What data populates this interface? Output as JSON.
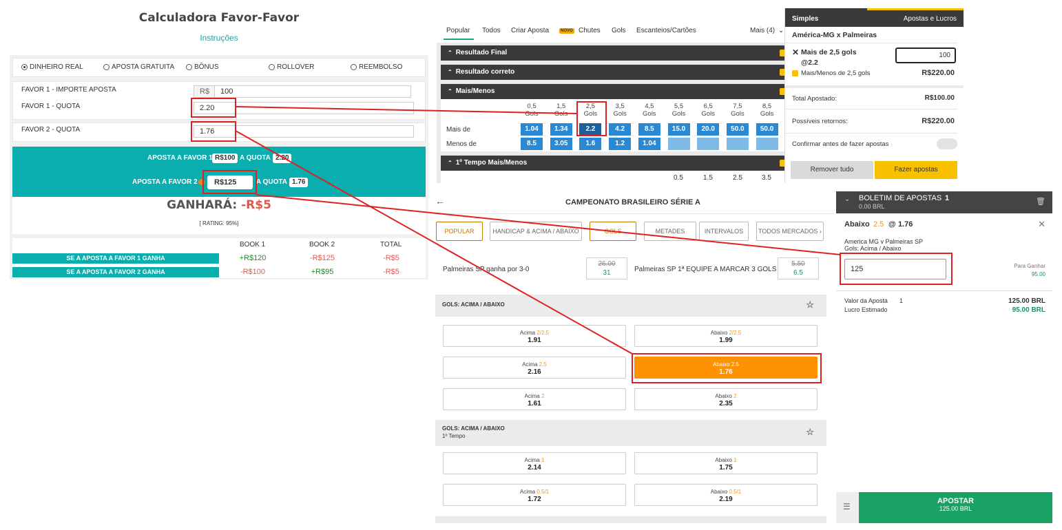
{
  "calc": {
    "title": "Calculadora Favor-Favor",
    "instructions": "Instruções",
    "radios": [
      "DINHEIRO REAL",
      "APOSTA GRATUITA",
      "BÔNUS",
      "ROLLOVER",
      "REEMBOLSO"
    ],
    "fav1_stake_label": "FAVOR 1 - IMPORTE APOSTA",
    "currency": "R$",
    "fav1_stake_value": "100",
    "fav1_odd_label": "FAVOR 1 - QUOTA",
    "fav1_odd_value": "2.20",
    "fav2_odd_label": "FAVOR 2 - QUOTA",
    "fav2_odd_value": "1.76",
    "bet1_label": "APOSTA A FAVOR 1",
    "bet1_amount": "R$100",
    "bet1_quota_label": "A QUOTA",
    "bet1_quota": "2.20",
    "bet2_label": "APOSTA A FAVOR 2",
    "bet2_amount": "R$125",
    "bet2_quota_label": "A QUOTA",
    "bet2_quota": "1.76",
    "win_label": "GANHARÁ:",
    "win_value": "-R$5",
    "rating": "[ RATING: 95%]",
    "table_headers": [
      "BOOK 1",
      "BOOK 2",
      "TOTAL"
    ],
    "rows": [
      {
        "label": "SE A APOSTA A FAVOR 1 GANHA",
        "book1": "+R$120",
        "book2": "-R$125",
        "total": "-R$5"
      },
      {
        "label": "SE A APOSTA A FAVOR 2 GANHA",
        "book1": "-R$100",
        "book2": "+R$95",
        "total": "-R$5"
      }
    ]
  },
  "b365": {
    "tabs": [
      "Popular",
      "Todos",
      "Criar Aposta",
      "Chutes",
      "Gols",
      "Escanteios/Cartões"
    ],
    "novo": "NOVO",
    "more": "Mais (4)",
    "sections": [
      "Resultado Final",
      "Resultado correto",
      "Mais/Menos",
      "1º Tempo Mais/Menos"
    ],
    "goal_word": "Gols",
    "goals": [
      "0,5",
      "1,5",
      "2,5",
      "3,5",
      "4,5",
      "5,5",
      "6,5",
      "7,5",
      "8,5"
    ],
    "over_label": "Mais de",
    "under_label": "Menos de",
    "over_odds": [
      "1.04",
      "1.34",
      "2.2",
      "4.2",
      "8.5",
      "15.0",
      "20.0",
      "50.0",
      "50.0"
    ],
    "under_odds": [
      "8.5",
      "3.05",
      "1.6",
      "1.2",
      "1.04",
      "",
      "",
      "",
      ""
    ],
    "half_goals": [
      "0.5",
      "1.5",
      "2.5",
      "3.5"
    ],
    "slip": {
      "simples": "Simples",
      "apostas_lucros": "Apostas e Lucros",
      "match": "América-MG x Palmeiras",
      "selection": "Mais de 2,5 gols",
      "odd": "@2.2",
      "stake": "100",
      "market": "Mais/Menos de 2,5 gols",
      "return": "R$220.00",
      "total_label": "Total Apostado:",
      "total_value": "R$100.00",
      "possible_label": "Possíveis retornos:",
      "possible_value": "R$220.00",
      "confirm": "Confirmar antes de fazer apostas",
      "remove": "Remover tudo",
      "place": "Fazer apostas"
    }
  },
  "bet2": {
    "title": "CAMPEONATO BRASILEIRO SÉRIE A",
    "pills": [
      "POPULAR",
      "HANDICAP & ACIMA / ABAIXO",
      "GOLS",
      "METADES",
      "INTERVALOS",
      "TODOS MERCADOS"
    ],
    "promo1": {
      "text": "Palmeiras SP ganha por 3-0",
      "old": "26.00",
      "new": "31"
    },
    "promo2": {
      "text": "Palmeiras SP 1ª EQUIPE A MARCAR 3 GOLS",
      "old": "5.50",
      "new": "6.5"
    },
    "section1": "GOLS: ACIMA / ABAIXO",
    "section2": "GOLS: ACIMA / ABAIXO",
    "section2_sub": "1º Tempo",
    "buttons1": [
      {
        "side": "Acima",
        "line": "2/2.5",
        "odd": "1.91"
      },
      {
        "side": "Abaixo",
        "line": "2/2.5",
        "odd": "1.99"
      },
      {
        "side": "Acima",
        "line": "2.5",
        "odd": "2.16"
      },
      {
        "side": "Abaixo",
        "line": "2.5",
        "odd": "1.76"
      },
      {
        "side": "Acima",
        "line": "2",
        "odd": "1.61"
      },
      {
        "side": "Abaixo",
        "line": "2",
        "odd": "2.35"
      }
    ],
    "buttons2": [
      {
        "side": "Acima",
        "line": "1",
        "odd": "2.14"
      },
      {
        "side": "Abaixo",
        "line": "1",
        "odd": "1.75"
      },
      {
        "side": "Acima",
        "line": "0.5/1",
        "odd": "1.72"
      },
      {
        "side": "Abaixo",
        "line": "0.5/1",
        "odd": "2.19"
      }
    ]
  },
  "slip2": {
    "title": "BOLETIM DE APOSTAS",
    "count": "1",
    "balance": "0.00 BRL",
    "selection_side": "Abaixo",
    "selection_line": "2.5",
    "at": "@",
    "selection_odd": "1.76",
    "match": "America MG v Palmeiras SP",
    "market": "Gols: Acima / Abaixo",
    "stake": "125",
    "to_win_label": "Para Ganhar",
    "to_win_value": "95.00",
    "stake_label": "Valor da Aposta",
    "stake_count": "1",
    "stake_value": "125.00 BRL",
    "profit_label": "Lucro Estimado",
    "profit_value": "95.00 BRL",
    "apostar": "APOSTAR",
    "apostar_amount": "125.00 BRL"
  },
  "colors": {
    "teal": "#0baeae",
    "annotation": "#e02020",
    "bet365_blue": "#2a89d2",
    "orange": "#ff9200",
    "green": "#1aa164",
    "yellow": "#f7c100"
  }
}
